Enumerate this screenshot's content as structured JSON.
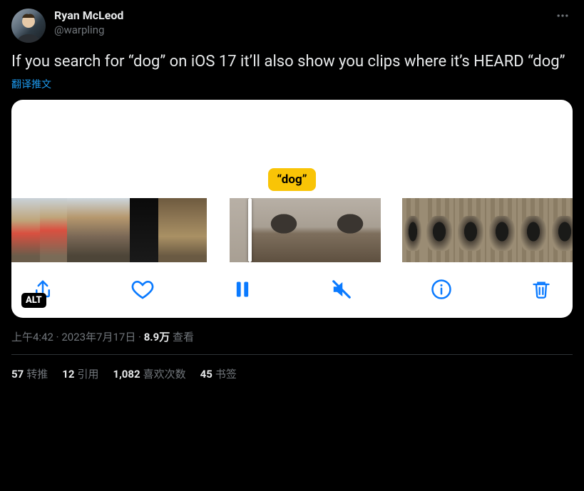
{
  "author": {
    "display_name": "Ryan McLeod",
    "handle": "@warpling"
  },
  "body": "If you search for “dog” on iOS 17 it’ll also show you clips where it’s HEARD “dog”",
  "translate_label": "翻译推文",
  "media": {
    "label": "“dog”",
    "alt_badge": "ALT"
  },
  "meta": {
    "time": "上午4:42",
    "dot1": " · ",
    "date": "2023年7月17日",
    "dot2": " · ",
    "views_count": "8.9万",
    "views_label": " 查看"
  },
  "stats": {
    "retweets_count": "57",
    "retweets_label": "转推",
    "quotes_count": "12",
    "quotes_label": "引用",
    "likes_count": "1,082",
    "likes_label": "喜欢次数",
    "bookmarks_count": "45",
    "bookmarks_label": "书签"
  }
}
